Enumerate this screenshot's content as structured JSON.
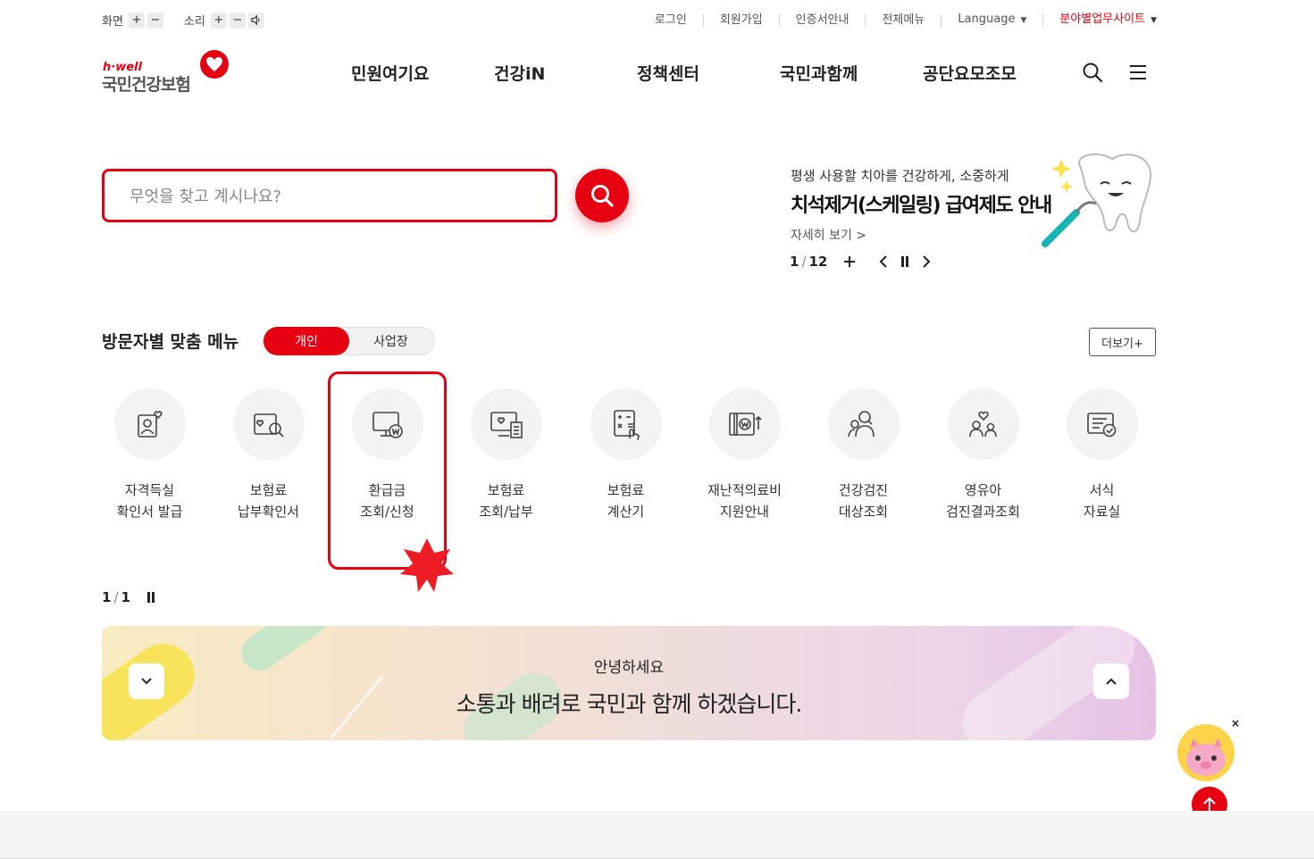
{
  "utility": {
    "screen_label": "화면",
    "sound_label": "소리",
    "plus": "+",
    "minus": "−",
    "links": [
      "로그인",
      "회원가입",
      "인증서안내",
      "전체메뉴"
    ],
    "language": "Language",
    "field_sites": "분야별업무사이트"
  },
  "logo": {
    "sub": "h·well",
    "main": "국민건강보험"
  },
  "gnb": [
    "민원여기요",
    "건강iN",
    "정책센터",
    "국민과함께",
    "공단요모조모"
  ],
  "search": {
    "placeholder": "무엇을 찾고 계시나요?"
  },
  "banner": {
    "subtitle": "평생 사용할 치아를 건강하게, 소중하게",
    "title": "치석제거(스케일링) 급여제도 안내",
    "more": "자세히 보기 >",
    "page_current": "1",
    "page_sep": "/",
    "page_total": "12"
  },
  "custom_menu": {
    "title": "방문자별 맞춤 메뉴",
    "tab_personal": "개인",
    "tab_business": "사업장",
    "more": "더보기+",
    "items": [
      {
        "line1": "자격득실",
        "line2": "확인서 발급",
        "icon": "person-heart-icon"
      },
      {
        "line1": "보험료",
        "line2": "납부확인서",
        "icon": "search-card-icon"
      },
      {
        "line1": "환급금",
        "line2": "조회/신청",
        "icon": "monitor-won-icon"
      },
      {
        "line1": "보험료",
        "line2": "조회/납부",
        "icon": "monitor-receipt-icon"
      },
      {
        "line1": "보험료",
        "line2": "계산기",
        "icon": "calculator-icon"
      },
      {
        "line1": "재난적의료비",
        "line2": "지원안내",
        "icon": "won-up-icon"
      },
      {
        "line1": "건강검진",
        "line2": "대상조회",
        "icon": "people-icon"
      },
      {
        "line1": "영유아",
        "line2": "검진결과조회",
        "icon": "family-heart-icon"
      },
      {
        "line1": "서식",
        "line2": "자료실",
        "icon": "document-check-icon"
      }
    ],
    "page_current": "1",
    "page_sep": "/",
    "page_total": "1"
  },
  "greeting": {
    "small": "안녕하세요",
    "big": "소통과 배려로 국민과 함께 하겠습니다."
  },
  "floating": {
    "close": "×"
  },
  "colors": {
    "brand_red": "#e60012"
  }
}
